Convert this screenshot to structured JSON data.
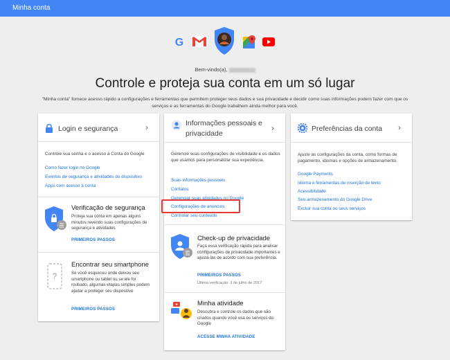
{
  "topbar": {
    "title": "Minha conta"
  },
  "welcome": {
    "text": "Bem-vindo(a),"
  },
  "headline": "Controle e proteja sua conta em um só lugar",
  "description": "\"Minha conta\" fornece acesso rápido a configurações e ferramentas que permitem proteger seus dados e sua privacidade e decidir como suas informações podem fazer com que os serviços e as ferramentas do Google trabalhem ainda melhor para você.",
  "login": {
    "title": "Login e segurança",
    "text": "Controle sua senha e o acesso à Conta do Google",
    "links": [
      "Como fazer login no Google",
      "Eventos de segurança e atividades do dispositivo",
      "Apps com acesso à conta"
    ],
    "checkup": {
      "title": "Verificação de segurança",
      "text": "Proteja sua conta em apenas alguns minutos revendo suas configurações de segurança e atividades",
      "cta": "PRIMEIROS PASSOS"
    },
    "phone": {
      "title": "Encontrar seu smartphone",
      "text": "Se você esqueceu onde deixou seu smartphone ou tablet ou se ele foi roubado, algumas etapas simples podem ajudar a proteger seu dispositivo",
      "cta": "PRIMEIROS PASSOS"
    }
  },
  "privacy": {
    "title_line1": "Informações pessoais e",
    "title_line2": "privacidade",
    "text": "Gerencie suas configurações de visibilidade e os dados que usamos para personalizar sua experiência.",
    "links": [
      "Suas informações pessoais",
      "Contatos",
      "Gerenciar suas atividades no Google",
      "Configurações de anúncios",
      "Controlar seu conteúdo"
    ],
    "checkup": {
      "title": "Check-up de privacidade",
      "text": "Faça essa verificação rápida para analisar configurações de privacidade importantes e ajustá-las de acordo com sua preferência.",
      "cta": "PRIMEIROS PASSOS",
      "note": "Última verificação: 3 de julho de 2017"
    },
    "activity": {
      "title": "Minha atividade",
      "text": "Descubra e controle os dados que são criados quando você usa os serviços do Google",
      "cta": "ACESSE MINHA ATIVIDADE"
    }
  },
  "prefs": {
    "title": "Preferências da conta",
    "text": "Ajuste as configurações da conta, como formas de pagamento, idiomas e opções de armazenamento.",
    "links": [
      "Google Payments",
      "Idioma e ferramentas de inserção de texto",
      "Acessibilidade",
      "Seu armazenamento do Google Drive",
      "Excluir sua conta ou seus serviços"
    ]
  },
  "colors": {
    "accent": "#4285f4",
    "link": "#1a73e8",
    "highlight": "#e53935"
  },
  "icons": [
    "google-g-icon",
    "gmail-icon",
    "profile-shield-icon",
    "maps-icon",
    "youtube-icon",
    "lock-icon",
    "person-icon",
    "gear-icon",
    "chevron-right-icon"
  ]
}
